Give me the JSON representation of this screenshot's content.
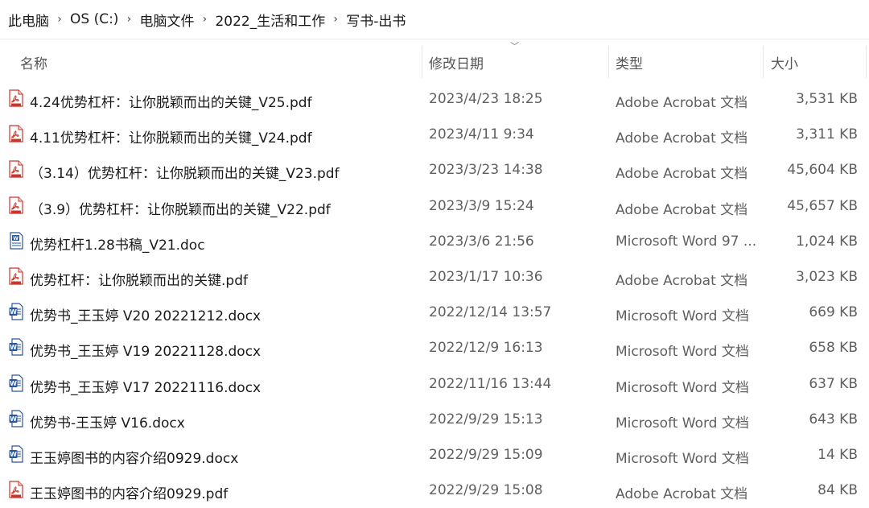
{
  "breadcrumb": [
    "此电脑",
    "OS (C:)",
    "电脑文件",
    "2022_生活和工作",
    "写书-出书"
  ],
  "columns": {
    "name": "名称",
    "date": "修改日期",
    "type": "类型",
    "size": "大小"
  },
  "files": [
    {
      "name": "4.24优势杠杆：让你脱颖而出的关键_V25.pdf",
      "date": "2023/4/23 18:25",
      "type": "Adobe Acrobat 文档",
      "size": "3,531 KB",
      "icon": "pdf-icon"
    },
    {
      "name": "4.11优势杠杆：让你脱颖而出的关键_V24.pdf",
      "date": "2023/4/11 9:34",
      "type": "Adobe Acrobat 文档",
      "size": "3,311 KB",
      "icon": "pdf-icon"
    },
    {
      "name": "（3.14）优势杠杆：让你脱颖而出的关键_V23.pdf",
      "date": "2023/3/23 14:38",
      "type": "Adobe Acrobat 文档",
      "size": "45,604 KB",
      "icon": "pdf-icon"
    },
    {
      "name": "（3.9）优势杠杆：让你脱颖而出的关键_V22.pdf",
      "date": "2023/3/9 15:24",
      "type": "Adobe Acrobat 文档",
      "size": "45,657 KB",
      "icon": "pdf-icon"
    },
    {
      "name": "优势杠杆1.28书稿_V21.doc",
      "date": "2023/3/6 21:56",
      "type": "Microsoft Word 97 ...",
      "size": "1,024 KB",
      "icon": "word-doc-icon"
    },
    {
      "name": "优势杠杆：让你脱颖而出的关键.pdf",
      "date": "2023/1/17 10:36",
      "type": "Adobe Acrobat 文档",
      "size": "3,023 KB",
      "icon": "pdf-icon"
    },
    {
      "name": "优势书_王玉婷 V20 20221212.docx",
      "date": "2022/12/14 13:57",
      "type": "Microsoft Word 文档",
      "size": "669 KB",
      "icon": "word-icon"
    },
    {
      "name": "优势书_王玉婷 V19 20221128.docx",
      "date": "2022/12/9 16:13",
      "type": "Microsoft Word 文档",
      "size": "658 KB",
      "icon": "word-icon"
    },
    {
      "name": "优势书_王玉婷 V17 20221116.docx",
      "date": "2022/11/16 13:44",
      "type": "Microsoft Word 文档",
      "size": "637 KB",
      "icon": "word-icon"
    },
    {
      "name": "优势书-王玉婷 V16.docx",
      "date": "2022/9/29 15:13",
      "type": "Microsoft Word 文档",
      "size": "643 KB",
      "icon": "word-icon"
    },
    {
      "name": "王玉婷图书的内容介绍0929.docx",
      "date": "2022/9/29 15:09",
      "type": "Microsoft Word 文档",
      "size": "14 KB",
      "icon": "word-icon"
    },
    {
      "name": "王玉婷图书的内容介绍0929.pdf",
      "date": "2022/9/29 15:08",
      "type": "Adobe Acrobat 文档",
      "size": "84 KB",
      "icon": "pdf-icon"
    }
  ]
}
